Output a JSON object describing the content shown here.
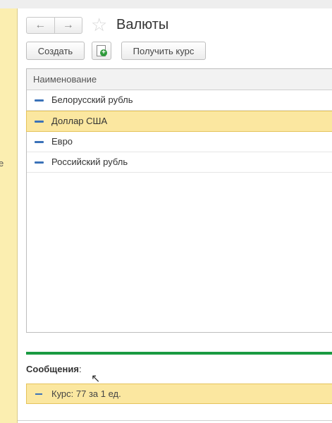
{
  "sidebar": {
    "fragment": "е"
  },
  "header": {
    "back_icon": "←",
    "forward_icon": "→",
    "star_icon": "☆",
    "title": "Валюты"
  },
  "toolbar": {
    "create_label": "Создать",
    "get_rate_label": "Получить курс"
  },
  "table": {
    "column_header": "Наименование",
    "rows": [
      {
        "name": "Белорусский рубль",
        "selected": false
      },
      {
        "name": "Доллар США",
        "selected": true
      },
      {
        "name": "Евро",
        "selected": false
      },
      {
        "name": "Российский рубль",
        "selected": false
      }
    ]
  },
  "messages": {
    "title": "Сообщения",
    "colon": ":",
    "items": [
      "Курс: 77 за 1 ед."
    ]
  },
  "colors": {
    "selection": "#fbe7a0",
    "sidebar": "#fbeeb0",
    "green_bar": "#1a9a42",
    "row_marker": "#3b72b8"
  }
}
